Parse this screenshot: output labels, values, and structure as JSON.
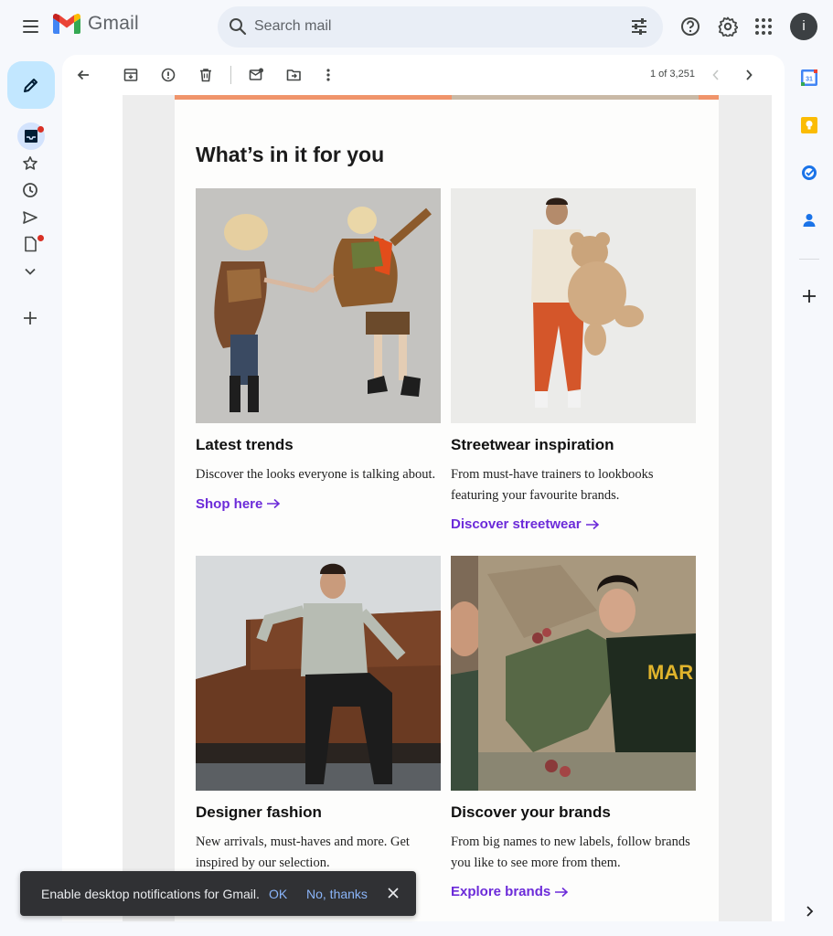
{
  "app": {
    "name": "Gmail",
    "avatar_letter": "i"
  },
  "search": {
    "placeholder": "Search mail"
  },
  "toolbar": {
    "pager": "1 of 3,251"
  },
  "email": {
    "section_title": "What’s in it for you",
    "cards": [
      {
        "heading": "Latest trends",
        "desc": "Discover the looks everyone is talking about.",
        "link": "Shop here"
      },
      {
        "heading": "Streetwear inspiration",
        "desc": "From must-have trainers to lookbooks featuring your favourite brands.",
        "link": "Discover streetwear"
      },
      {
        "heading": "Designer fashion",
        "desc": "New arrivals, must-haves and more. Get inspired by our selection.",
        "link": ""
      },
      {
        "heading": "Discover your brands",
        "desc": "From big names to new labels, follow brands you like to see more from them.",
        "link": "Explore brands"
      }
    ]
  },
  "right_rail": {
    "calendar_day": "31"
  },
  "snackbar": {
    "message": "Enable desktop notifications for Gmail.",
    "ok": "OK",
    "no": "No, thanks"
  },
  "colors": {
    "accent_link": "#6c2bd9",
    "compose_bg": "#c2e7ff",
    "banner": "#f0946b"
  }
}
